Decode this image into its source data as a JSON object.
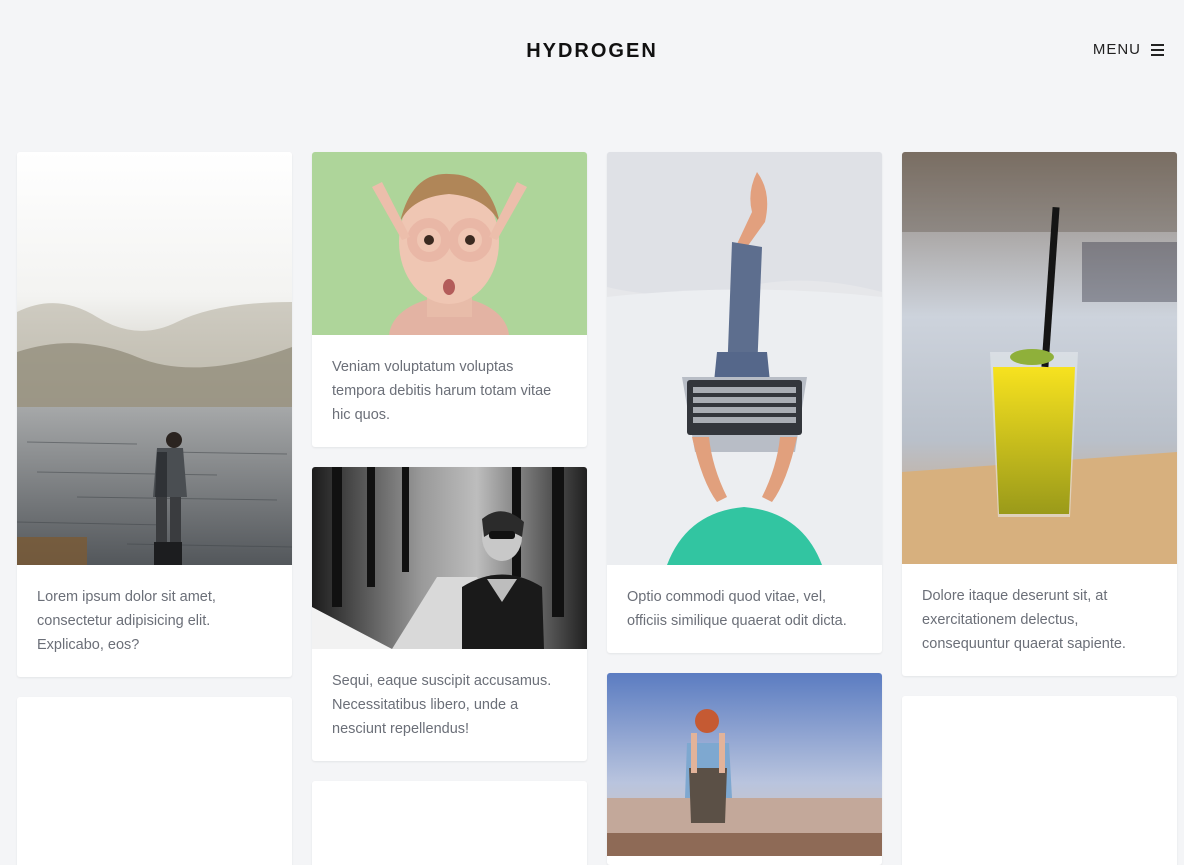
{
  "header": {
    "logo": "HYDROGEN",
    "menu_label": "MENU"
  },
  "cards": [
    {
      "caption": "Lorem ipsum dolor sit amet, consectetur adipisicing elit. Explicabo, eos?",
      "image": "person-standing-by-misty-lake"
    },
    {
      "caption": "Veniam voluptatum voluptas tempora debitis harum totam vitae hic quos.",
      "image": "woman-making-finger-goggles-on-green"
    },
    {
      "caption": "Sequi, eaque suscipit accusamus. Necessitatibus libero, unde a nesciunt repellendus!",
      "image": "black-and-white-woman-in-forest-path"
    },
    {
      "caption": "Optio commodi quod vitae, vel, officiis similique quaerat odit dicta.",
      "image": "person-with-laptop-on-lap"
    },
    {
      "caption": "Dolore itaque deserunt sit, at exercitationem delectus, consequuntur quaerat sapiente.",
      "image": "glass-of-orange-juice-with-straw"
    },
    {
      "caption": "",
      "image": "woman-with-backpack-overlooking-city"
    }
  ],
  "colors": {
    "background": "#f4f5f7",
    "card": "#ffffff",
    "text": "#6b6f78",
    "logo": "#111111"
  }
}
